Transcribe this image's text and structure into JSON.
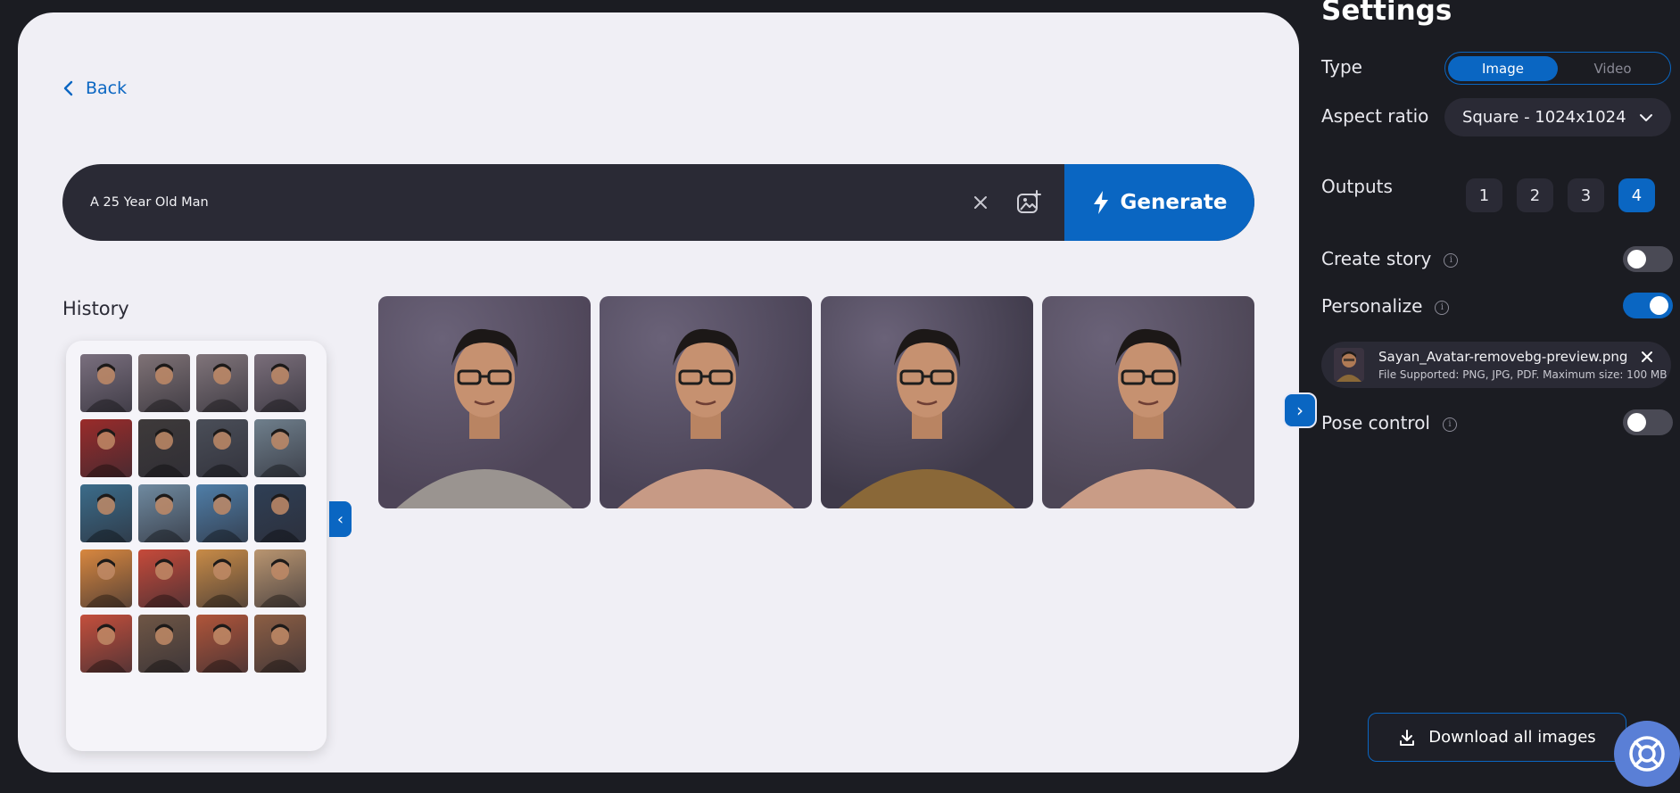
{
  "nav": {
    "back_label": "Back"
  },
  "prompt": {
    "value": "A 25 Year Old Man",
    "generate_label": "Generate"
  },
  "history": {
    "title": "History",
    "thumbs": [
      "#7a6f7e",
      "#7f7276",
      "#80747a",
      "#7a6e7a",
      "#9a2b2a",
      "#3e3a3a",
      "#4a4e58",
      "#6f7f8c",
      "#3b6c8a",
      "#6f8aa0",
      "#4f7ea8",
      "#2f3f55",
      "#d8873f",
      "#c64a3a",
      "#c88b47",
      "#b99570",
      "#c44f3c",
      "#6f5645",
      "#b0553a",
      "#8c5e44"
    ]
  },
  "outputs_gallery": {
    "images": [
      {
        "alt": "output-1",
        "bg": "#4e4558",
        "shirt": "#9a9490"
      },
      {
        "alt": "output-2",
        "bg": "#4a4356",
        "shirt": "#c79a85"
      },
      {
        "alt": "output-3",
        "bg": "#3f3a4a",
        "shirt": "#8a6838"
      },
      {
        "alt": "output-4",
        "bg": "#4d4656",
        "shirt": "#c99c86"
      }
    ]
  },
  "settings": {
    "title": "Settings",
    "type_label": "Type",
    "type_options": [
      "Image",
      "Video"
    ],
    "type_selected": "Image",
    "aspect_label": "Aspect ratio",
    "aspect_value": "Square - 1024x1024",
    "outputs_label": "Outputs",
    "outputs_options": [
      "1",
      "2",
      "3",
      "4"
    ],
    "outputs_selected": "4",
    "create_story_label": "Create story",
    "create_story_on": false,
    "personalize_label": "Personalize",
    "personalize_on": true,
    "file": {
      "name": "Sayan_Avatar-removebg-preview.png",
      "note": "File Supported: PNG, JPG, PDF. Maximum size: 100 MB"
    },
    "pose_control_label": "Pose control",
    "pose_control_on": false,
    "download_label": "Download all images"
  },
  "colors": {
    "accent": "#0a66c2",
    "panel": "#1b1c22",
    "card": "#f0eff5",
    "field": "#2a2a35"
  }
}
